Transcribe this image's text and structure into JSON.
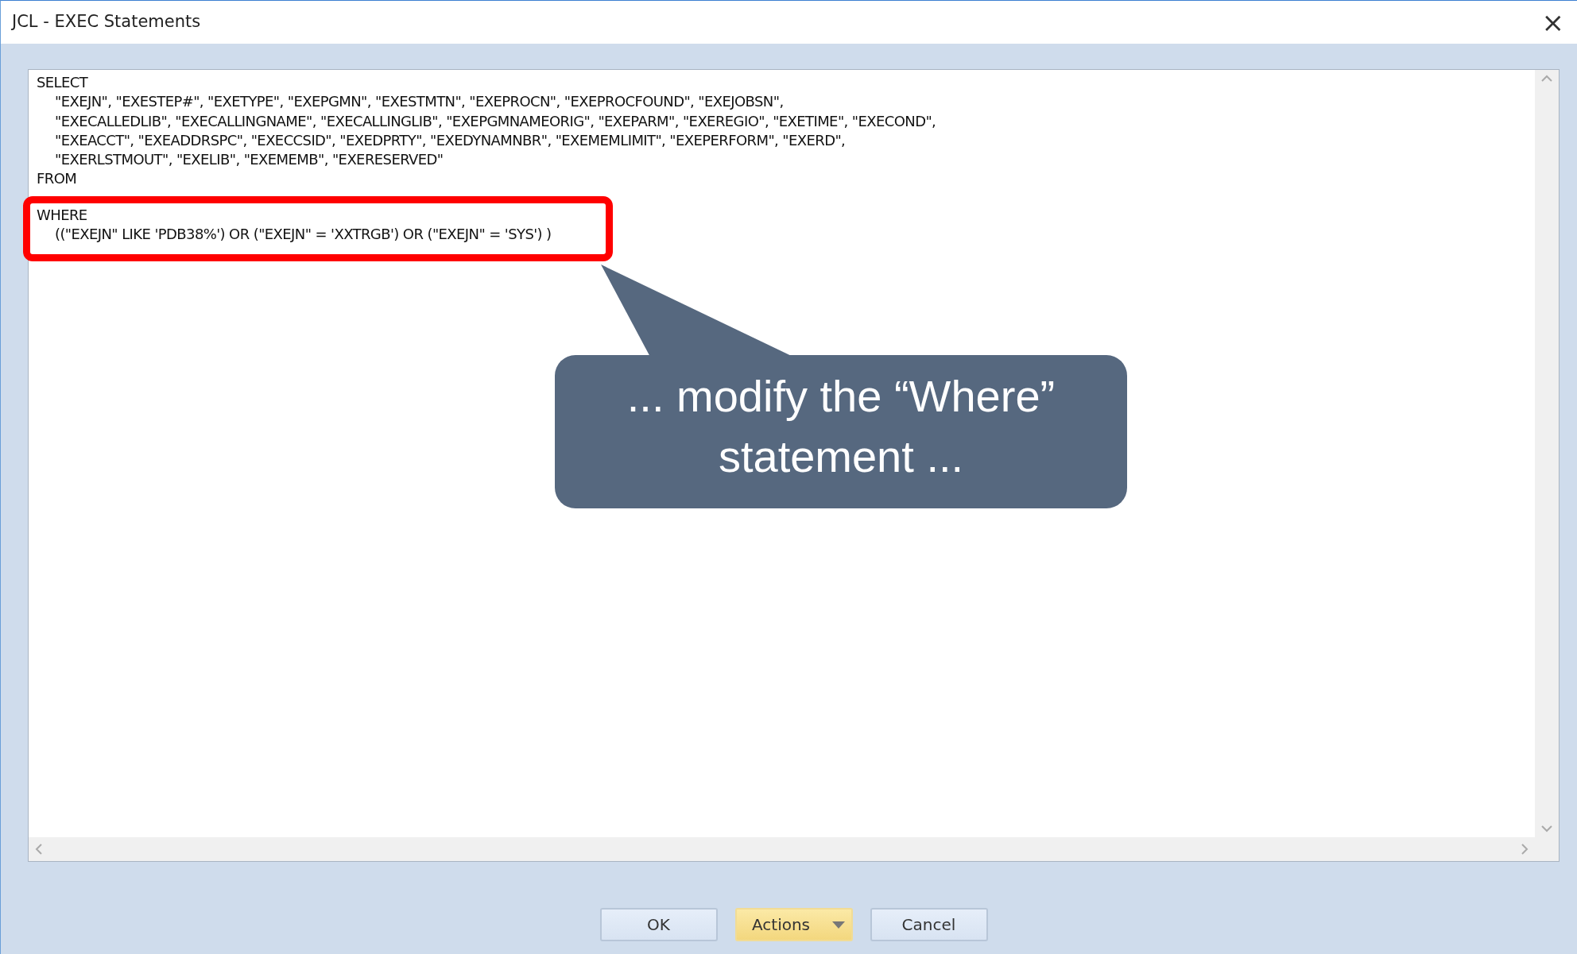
{
  "window": {
    "title": "JCL - EXEC Statements",
    "close": "×"
  },
  "editor": {
    "clauses": [
      {
        "keyword": "SELECT",
        "body": [
          "\"EXEJN\", \"EXESTEP#\", \"EXETYPE\", \"EXEPGMN\", \"EXESTMTN\", \"EXEPROCN\", \"EXEPROCFOUND\", \"EXEJOBSN\",",
          "\"EXECALLEDLIB\", \"EXECALLINGNAME\", \"EXECALLINGLIB\", \"EXEPGMNAMEORIG\", \"EXEPARM\", \"EXEREGIO\", \"EXETIME\", \"EXECOND\",",
          "\"EXEACCT\", \"EXEADDRSPC\", \"EXECCSID\", \"EXEDPRTY\", \"EXEDYNAMNBR\", \"EXEMEMLIMIT\", \"EXEPERFORM\", \"EXERD\",",
          "\"EXERLSTMOUT\", \"EXELIB\", \"EXEMEMB\", \"EXERESERVED\""
        ]
      },
      {
        "keyword": "FROM"
      }
    ],
    "highlighted_clauses": [
      {
        "keyword": "WHERE",
        "body": [
          "((\"EXEJN\" LIKE 'PDB38%') OR (\"EXEJN\" = 'XXTRGB') OR (\"EXEJN\" = 'SYS') )"
        ]
      }
    ]
  },
  "callout": {
    "text": "... modify the “Where” statement ..."
  },
  "buttons": [
    {
      "label": "OK",
      "kind": "plain"
    },
    {
      "label": "Actions",
      "kind": "dropdown"
    },
    {
      "label": "Cancel",
      "kind": "plain"
    }
  ]
}
